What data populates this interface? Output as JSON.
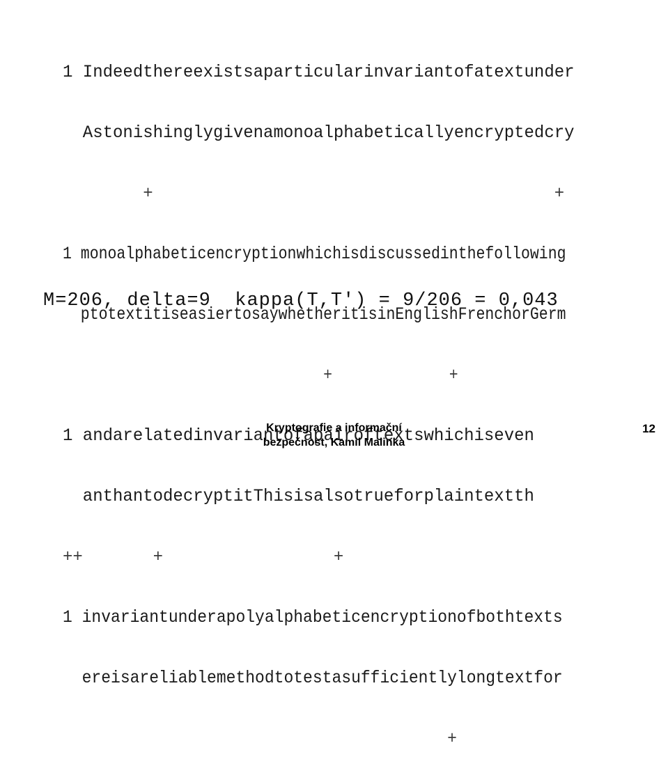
{
  "slide": {
    "page_number": "12",
    "footer_line_1": "Kryptografie a informační",
    "footer_line_2": "bezpečnost, Kamil Malinka"
  },
  "body": {
    "lines": [
      {
        "id": "line-1",
        "type": "text",
        "text": "1 Indeedthereexistsaparticularinvariantofatextunder"
      },
      {
        "id": "line-2",
        "type": "text",
        "text": "  Astonishinglygivenamonoalphabeticallyencryptedcry"
      },
      {
        "id": "line-3",
        "type": "plus",
        "text": "        +                                        +"
      },
      {
        "id": "line-4",
        "type": "text",
        "text": "1 monoalphabeticencryptionwhichisdiscussedinthefollowing"
      },
      {
        "id": "line-5",
        "type": "text",
        "text": "  ptotextitiseasiertosaywhetheritisinEnglishFrenchorGerm"
      },
      {
        "id": "line-6",
        "type": "plus",
        "text": "                             +             +"
      },
      {
        "id": "line-7",
        "type": "text",
        "text": "1 andarelatedinvariantofapairoftextswhichiseven"
      },
      {
        "id": "line-8",
        "type": "text",
        "text": "  anthantodecryptitThisisalsotrueforplaintextth"
      },
      {
        "id": "line-9",
        "type": "plus",
        "text": "++       +                 +"
      },
      {
        "id": "line-10",
        "type": "text",
        "text": "1 invariantunderapolyalphabeticencryptionofbothtexts"
      },
      {
        "id": "line-11",
        "type": "text",
        "text": "  ereisareliablemethodtotestasufficientlylongtextfor"
      },
      {
        "id": "line-12",
        "type": "plus",
        "text": "                                        +"
      }
    ],
    "formula": "M=206, delta=9  kappa(T,T') = 9/206 = 0,043",
    "formula_parts": {
      "alphabet_size_label": "M",
      "alphabet_size_value": "206",
      "delta_label": "delta",
      "delta_value": "9",
      "kappa_expression": "kappa(T,T')",
      "fraction": "9/206",
      "result": "0,043"
    }
  },
  "colors": {
    "background": "#ffffff",
    "text": "#1a1a1a",
    "footer_text": "#000000"
  }
}
